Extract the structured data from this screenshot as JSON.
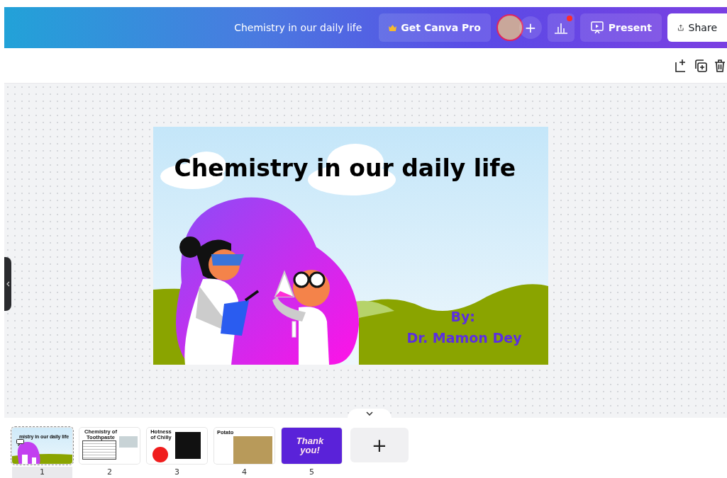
{
  "top_bar": {
    "title": "Chemistry in our daily life",
    "pro_button": "Get Canva Pro",
    "add_person": "+",
    "analytics_notification": true,
    "present": "Present",
    "share": "Share"
  },
  "slide": {
    "title": "Chemistry in our daily life",
    "byline": "By:",
    "author": "Dr. Mamon Dey"
  },
  "pages": [
    {
      "number": "1",
      "selected": true,
      "kind": "title",
      "title": "mistry in our daily life"
    },
    {
      "number": "2",
      "selected": false,
      "kind": "text",
      "title": "Chemistry of Toothpaste"
    },
    {
      "number": "3",
      "selected": false,
      "kind": "dark",
      "title": "Hotness of Chilly"
    },
    {
      "number": "4",
      "selected": false,
      "kind": "photo",
      "title": "Potato"
    },
    {
      "number": "5",
      "selected": false,
      "kind": "thanks",
      "title": "Thank you!"
    }
  ],
  "add_page": "+"
}
